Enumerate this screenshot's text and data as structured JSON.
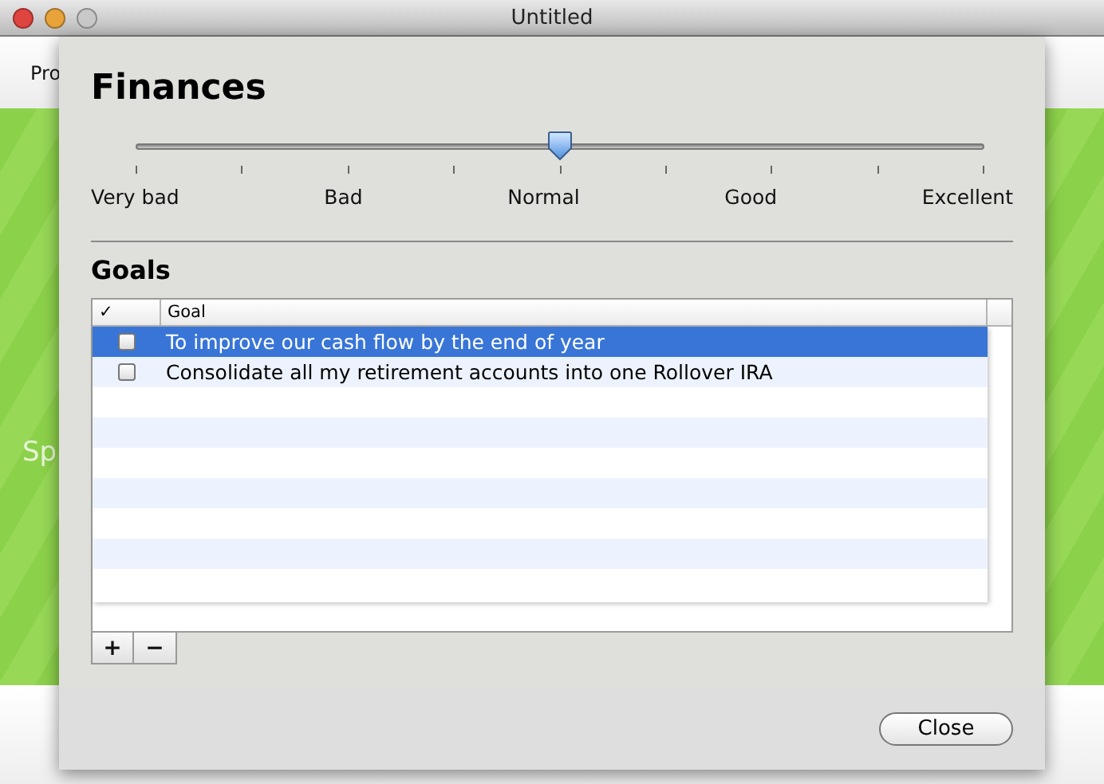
{
  "window": {
    "title": "Untitled",
    "project_label": "Pro",
    "side_label": "Sp"
  },
  "sheet": {
    "title": "Finances",
    "rating": {
      "level": 0.5,
      "labels": [
        "Very bad",
        "Bad",
        "Normal",
        "Good",
        "Excellent"
      ]
    },
    "goals": {
      "title": "Goals",
      "columns": [
        "✓",
        "Goal"
      ],
      "rows": [
        {
          "text": "To improve our cash flow by the end of year",
          "checked": false,
          "selected": true
        },
        {
          "text": "Consolidate all my retirement accounts into one Rollover IRA",
          "checked": false,
          "selected": false
        }
      ]
    },
    "add_button": "+",
    "remove_button": "−",
    "close_button": "Close"
  }
}
